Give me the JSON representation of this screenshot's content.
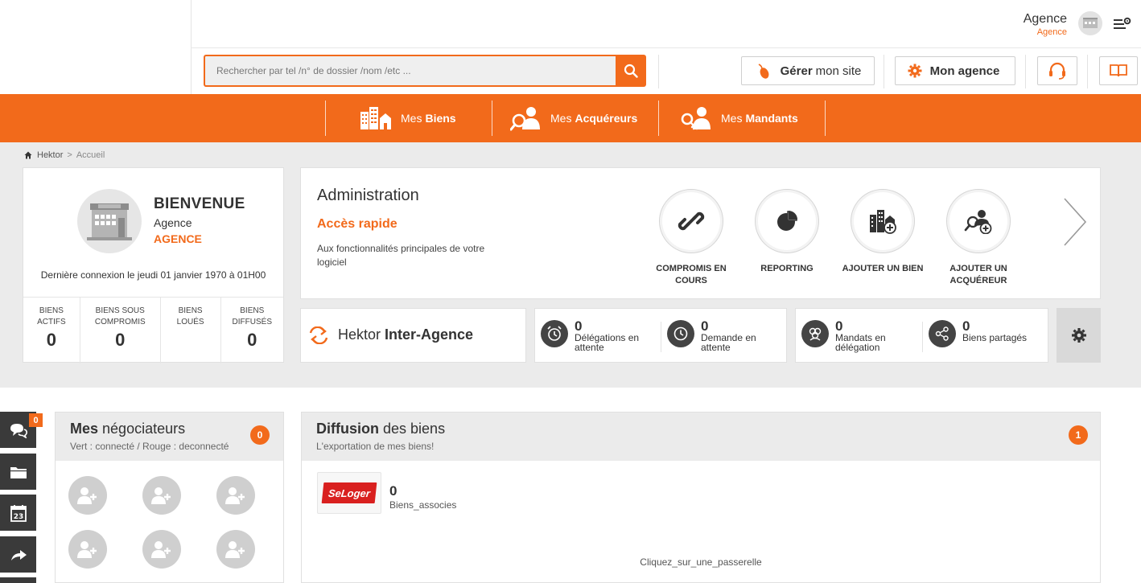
{
  "header": {
    "user_name": "Agence",
    "user_role": "Agence",
    "search_placeholder": "Rechercher par tel /n° de dossier /nom /etc ...",
    "btn_site_bold": "Gérer",
    "btn_site_rest": "mon site",
    "btn_agency": "Mon agence"
  },
  "nav": {
    "items": [
      {
        "prefix": "Mes",
        "bold": "Biens"
      },
      {
        "prefix": "Mes",
        "bold": "Acquéreurs"
      },
      {
        "prefix": "Mes",
        "bold": "Mandants"
      }
    ]
  },
  "breadcrumb": {
    "root": "Hektor",
    "sep": ">",
    "current": "Accueil"
  },
  "welcome": {
    "title": "BIENVENUE",
    "name": "Agence",
    "agency": "AGENCE",
    "last_login": "Dernière connexion le jeudi 01 janvier 1970 à 01H00",
    "stats": [
      {
        "label": "BIENS ACTIFS",
        "value": "0"
      },
      {
        "label": "BIENS SOUS COMPROMIS",
        "value": "0"
      },
      {
        "label": "BIENS LOUÉS",
        "value": ""
      },
      {
        "label": "BIENS DIFFUSÉS",
        "value": "0"
      }
    ]
  },
  "admin": {
    "title": "Administration",
    "subtitle": "Accès rapide",
    "description": "Aux fonctionnalités principales de votre logiciel",
    "actions": [
      {
        "label": "COMPROMIS EN COURS",
        "icon": "link-icon"
      },
      {
        "label": "REPORTING",
        "icon": "pie-chart-icon"
      },
      {
        "label": "AJOUTER UN BIEN",
        "icon": "add-building-icon"
      },
      {
        "label": "AJOUTER UN ACQUÉREUR",
        "icon": "add-buyer-icon"
      }
    ]
  },
  "interagence": {
    "label_prefix": "Hektor",
    "label_bold": "Inter-Agence",
    "stats": [
      {
        "value": "0",
        "label": "Délégations en attente",
        "icon": "alarm-clock-icon"
      },
      {
        "value": "0",
        "label": "Demande en attente",
        "icon": "clock-icon"
      },
      {
        "value": "0",
        "label": "Mandats en délégation",
        "icon": "group-icon"
      },
      {
        "value": "0",
        "label": "Biens partagés",
        "icon": "share-icon"
      }
    ]
  },
  "sidebar": {
    "chat_count": "0"
  },
  "negociateurs": {
    "title_bold": "Mes",
    "title_rest": "négociateurs",
    "subtitle": "Vert : connecté / Rouge : deconnecté",
    "count": "0"
  },
  "diffusion": {
    "title_bold": "Diffusion",
    "title_rest": "des biens",
    "subtitle": "L'exportation de mes biens!",
    "count": "1",
    "portal_logo": "SeLoger",
    "portal_value": "0",
    "portal_label": "Biens_associes",
    "cta": "Cliquez_sur_une_passerelle"
  },
  "colors": {
    "accent": "#f26a1b",
    "dark": "#3a3a3a",
    "grey_bg": "#ebebeb"
  }
}
